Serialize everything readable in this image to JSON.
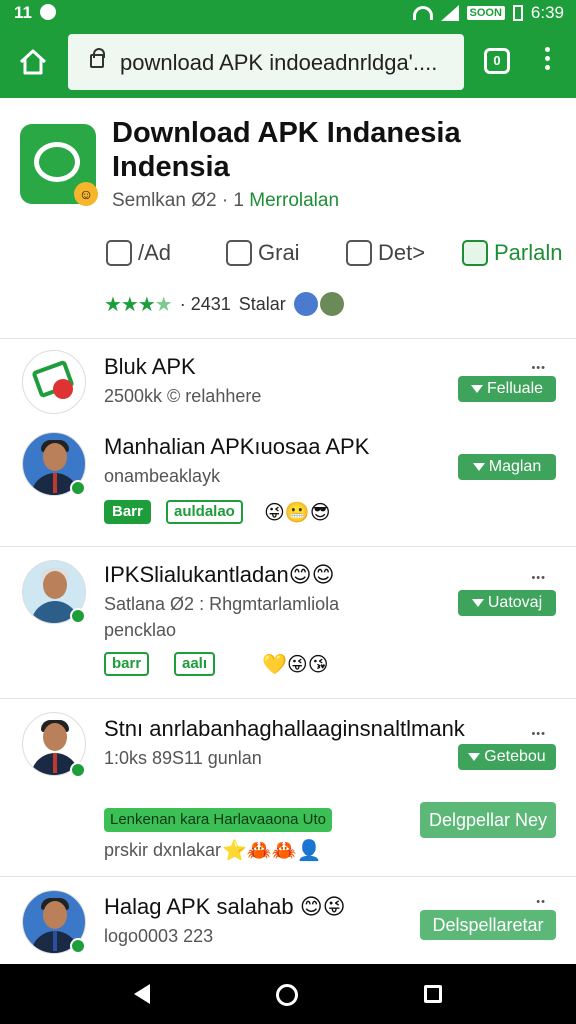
{
  "status_bar": {
    "time_left": "11",
    "time_right": "6:39",
    "battery_label": "SOON"
  },
  "toolbar": {
    "url": "pownload APK indoeadnrldga'....",
    "tabs_count": "0"
  },
  "app": {
    "title_line1": "Download APK Indanesia",
    "title_line2": "Indensia",
    "subtitle_gray": "Semlkan Ø2 · 1",
    "subtitle_green": "Merrolalan"
  },
  "actions": [
    {
      "label": "/Ad"
    },
    {
      "label": "Grai"
    },
    {
      "label": "Det>"
    },
    {
      "label": "Parlaln"
    }
  ],
  "rating": {
    "stars": "★★★",
    "half": "★",
    "count": "· 2431",
    "label": "Stalar"
  },
  "items": [
    {
      "title": "Bluk APK",
      "sub": "2500kk © relahhere",
      "button": "Felluale",
      "more": "•••"
    },
    {
      "title": "Manhalian APKıuosaa APK",
      "sub": "onambeaklayk",
      "button": "Maglan",
      "tag1": "Barr",
      "tag2": "auldalao",
      "emojis": "😜😬😎"
    },
    {
      "title": "IPKSlialukantladan😊😊",
      "sub": "Satlana Ø2 : Rhgmtarlamliola",
      "sub2": "pencklao",
      "button": "Uatovaj",
      "more": "•••",
      "tag1": "barr",
      "tag2": "aalı",
      "emojis": "💛😜😘"
    },
    {
      "title": "Stnı anrlabanhaghallaaginsnaltlmank",
      "sub": "1:0ks 89S11 gunlan",
      "button": "Getebou",
      "more": "•••",
      "highlight": "Lenkenan kara Harlavaaona Uto",
      "sub2": "prskir dxnlakar",
      "emojis": "⭐🦀🦀👤",
      "button2": "Delgpellar Ney"
    },
    {
      "title": "Halag APK salahab 😊😜",
      "sub": "logo0003 223",
      "button": "Delspellaretar",
      "more": "••"
    }
  ]
}
